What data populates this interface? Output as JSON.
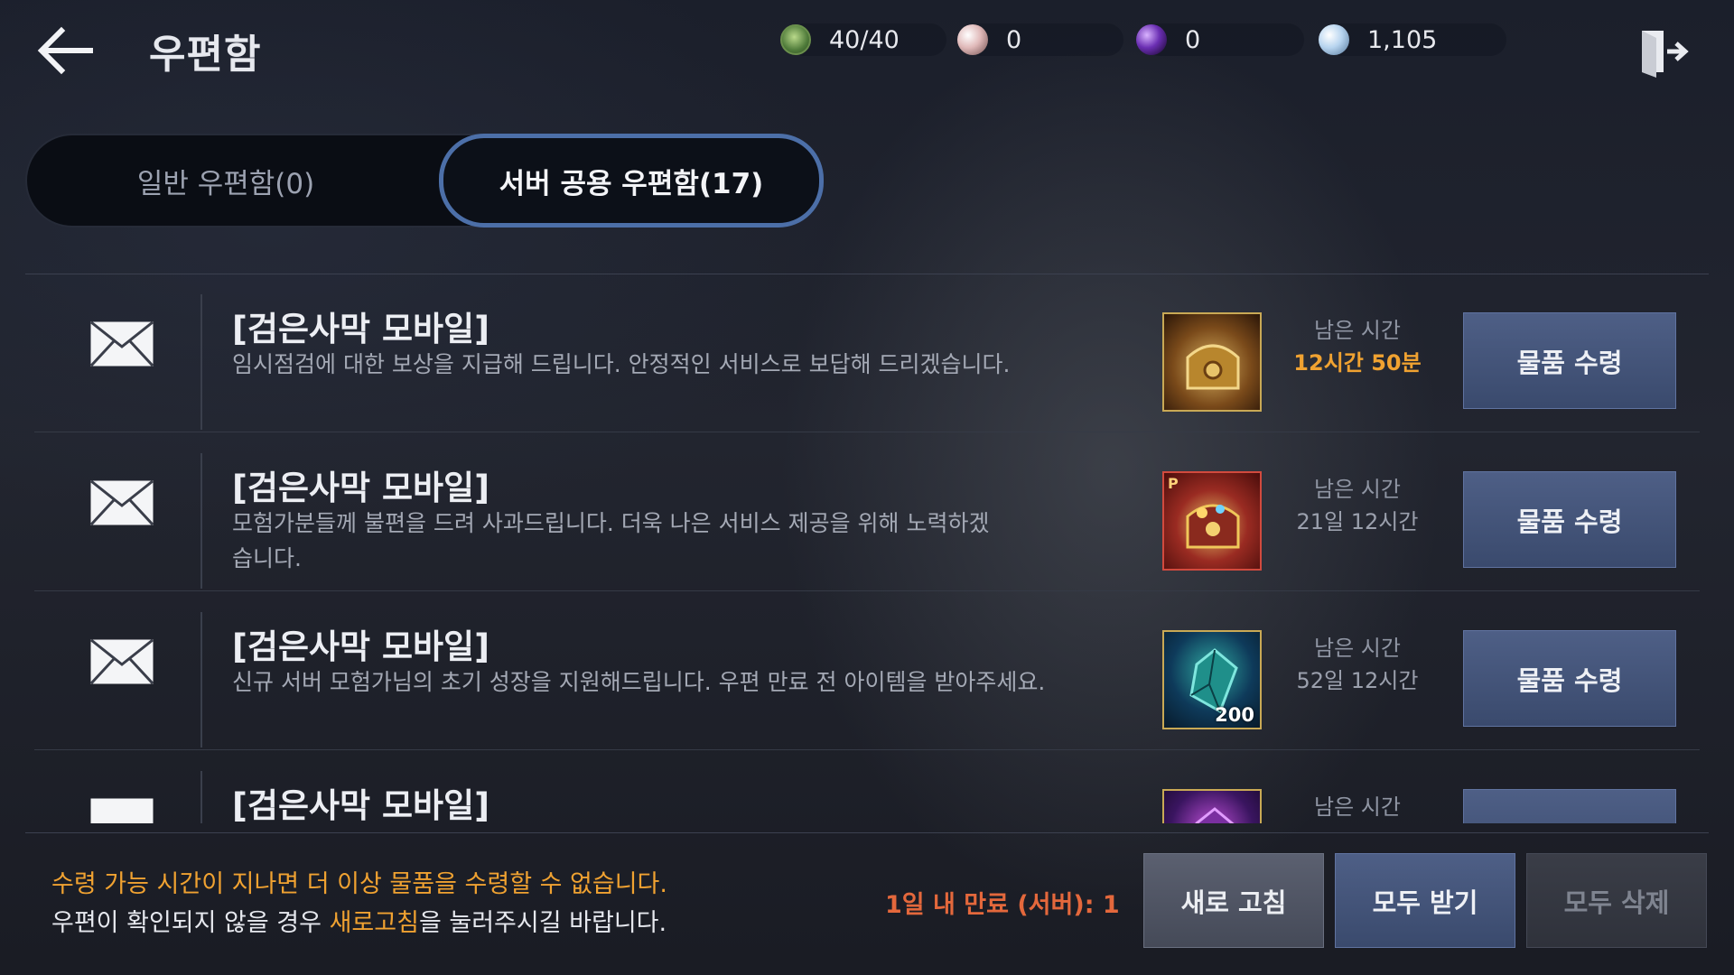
{
  "header": {
    "title": "우편함",
    "resources": [
      {
        "icon": "stamina-icon",
        "value": "40/40"
      },
      {
        "icon": "pearl-icon",
        "value": "0"
      },
      {
        "icon": "black-orb-icon",
        "value": "0"
      },
      {
        "icon": "silver-coin-icon",
        "value": "1,105"
      }
    ]
  },
  "tabs": {
    "normal": "일반 우편함(0)",
    "server": "서버 공용 우편함(17)",
    "active": "server"
  },
  "remain_label": "남은 시간",
  "claim_label": "물품 수령",
  "mails": [
    {
      "title": "[검은사막 모바일]",
      "body": "임시점검에 대한 보상을 지급해 드립니다. 안정적인 서비스로 보답해 드리겠습니다.",
      "item_icon": "golden-chest-icon",
      "remaining": "12시간 50분",
      "remaining_highlight": true
    },
    {
      "title": "[검은사막 모바일]",
      "body": "모험가분들께 불편을 드려 사과드립니다. 더욱 나은 서비스 제공을 위해 노력하겠습니다.",
      "item_icon": "premium-treasure-chest-icon",
      "item_tag": "P",
      "remaining": "21일 12시간",
      "remaining_highlight": false
    },
    {
      "title": "[검은사막 모바일]",
      "body": "신규 서버 모험가님의 초기 성장을 지원해드립니다. 우편 만료 전 아이템을 받아주세요.",
      "item_icon": "blue-crystal-icon",
      "item_qty": "200",
      "remaining": "52일 12시간",
      "remaining_highlight": false
    },
    {
      "title": "[검은사막 모바일]",
      "body": "",
      "item_icon": "purple-crystal-icon",
      "remaining": "",
      "remaining_highlight": false
    }
  ],
  "footer": {
    "notice_line1": "수령 가능 시간이 지나면 더 이상 물품을 수령할 수 없습니다.",
    "notice_line2_pre": "우편이 확인되지 않을 경우 ",
    "notice_line2_hl": "새로고침",
    "notice_line2_post": "을 눌러주시길 바랍니다.",
    "expire_text": "1일 내 만료 (서버): 1",
    "refresh_label": "새로 고침",
    "receive_all_label": "모두 받기",
    "delete_all_label": "모두 삭제"
  },
  "colors": {
    "accent_orange": "#f0a231",
    "expire_red": "#e4683c",
    "tab_border_blue": "#4c6fa8",
    "button_blue": "#4e5f86"
  }
}
